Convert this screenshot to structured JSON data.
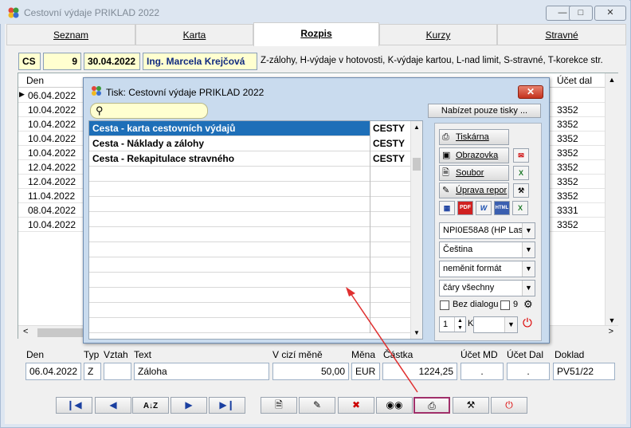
{
  "window": {
    "title": "Cestovní výdaje PRIKLAD 2022"
  },
  "tabs": [
    {
      "label": "Seznam"
    },
    {
      "label": "Karta"
    },
    {
      "label": "Rozpis"
    },
    {
      "label": "Kurzy"
    },
    {
      "label": "Stravné"
    }
  ],
  "header": {
    "code": "CS",
    "number": "9",
    "date": "30.04.2022",
    "person": "Ing. Marcela Krejčová",
    "legend": "Z-zálohy, H-výdaje v hotovosti, K-výdaje kartou, L-nad limit, S-stravné, T-korekce str."
  },
  "grid": {
    "col_den": "Den",
    "col_ucet": "Účet dal",
    "rows": [
      {
        "den": "06.04.2022",
        "ucet": ""
      },
      {
        "den": "10.04.2022",
        "ucet": "3352"
      },
      {
        "den": "10.04.2022",
        "ucet": "3352"
      },
      {
        "den": "10.04.2022",
        "ucet": "3352"
      },
      {
        "den": "10.04.2022",
        "ucet": "3352"
      },
      {
        "den": "12.04.2022",
        "ucet": "3352"
      },
      {
        "den": "12.04.2022",
        "ucet": "3352"
      },
      {
        "den": "11.04.2022",
        "ucet": "3352"
      },
      {
        "den": "08.04.2022",
        "ucet": "3331"
      },
      {
        "den": "10.04.2022",
        "ucet": "3352"
      }
    ]
  },
  "detail": {
    "labels": {
      "den": "Den",
      "typ": "Typ",
      "vztah": "Vztah",
      "text": "Text",
      "cizi": "V cizí měně",
      "mena": "Měna",
      "castka": "Částka",
      "ucet_md": "Účet MD",
      "ucet_dal": "Účet Dal",
      "doklad": "Doklad"
    },
    "values": {
      "den": "06.04.2022",
      "typ": "Z",
      "vztah": "",
      "text": "Záloha",
      "cizi": "50,00",
      "mena": "EUR",
      "castka": "1224,25",
      "ucet_md": ".",
      "ucet_dal": ".",
      "doklad": "PV51/22"
    }
  },
  "dialog": {
    "title": "Tisk: Cestovní výdaje PRIKLAD 2022",
    "search_placeholder": "",
    "offer_button": "Nabízet pouze tisky ...",
    "reports": [
      {
        "name": "Cesta - karta cestovních výdajů",
        "tag": "CESTY"
      },
      {
        "name": "Cesta - Náklady a zálohy",
        "tag": "CESTY"
      },
      {
        "name": "Cesta - Rekapitulace stravného",
        "tag": "CESTY"
      }
    ],
    "buttons": {
      "tiskarna": "Tiskárna",
      "obrazovka": "Obrazovka",
      "soubor": "Soubor",
      "uprava": "Úprava repor"
    },
    "printer": "NPI0E58A8 (HP Lase",
    "language": "Čeština",
    "format": "neměnit formát",
    "lines": "čáry všechny",
    "bez_dialogu": "Bez dialogu",
    "copies_count": "9",
    "copies": "1",
    "k_label": "K"
  }
}
